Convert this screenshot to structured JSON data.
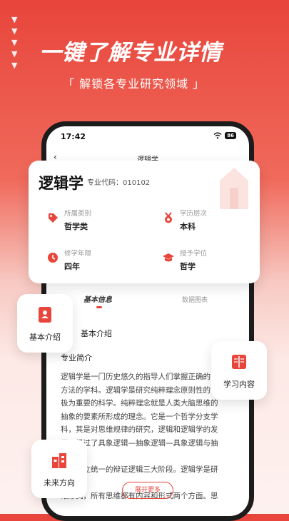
{
  "header": {
    "headline": "一键了解专业详情",
    "subline": "「 解锁各专业研究领域 」",
    "arrow_glyph": "▼"
  },
  "phone": {
    "status_time": "17:42",
    "battery": "86",
    "nav_title": "逻辑学"
  },
  "card": {
    "major_name": "逻辑学",
    "major_code": "专业代码：010102",
    "items": [
      {
        "label": "所属类别",
        "value": "哲学类",
        "icon": "tag-icon"
      },
      {
        "label": "学历层次",
        "value": "本科",
        "icon": "medal-icon"
      },
      {
        "label": "修学年限",
        "value": "四年",
        "icon": "clock-icon"
      },
      {
        "label": "授予学位",
        "value": "哲学",
        "icon": "graduation-cap-icon"
      }
    ]
  },
  "tabs": {
    "basic": "基本信息",
    "chart": "数据图表"
  },
  "content": {
    "intro_title": "基本介绍",
    "brief_title": "专业简介",
    "body_lines": [
      "逻辑学是一门历史悠久的指导人们掌握正确的",
      "方法的学科。逻辑学是研究纯粹理念原则性的",
      "极为重要的科学。纯粹理念就是人类大脑思维的",
      "抽象的要素所形成的理念。它是一个哲学分支学",
      "科，其是对思维规律的研究，逻辑和逻辑学的发",
      "展，经过了具象逻辑—抽象逻辑—具象逻辑与抽象",
      "——对立统一的辩证逻辑三大阶段。逻辑学是研究思",
      "维形式，所有思维都有内容和形式两个方面。思"
    ],
    "more_button": "展开更多"
  },
  "floats": {
    "basic_intro": "基本介绍",
    "study_content": "学习内容",
    "future_direction": "未来方向"
  },
  "colors": {
    "accent": "#e8453b",
    "background_top": "#e8453b",
    "background_bottom": "#fdf1ef"
  }
}
